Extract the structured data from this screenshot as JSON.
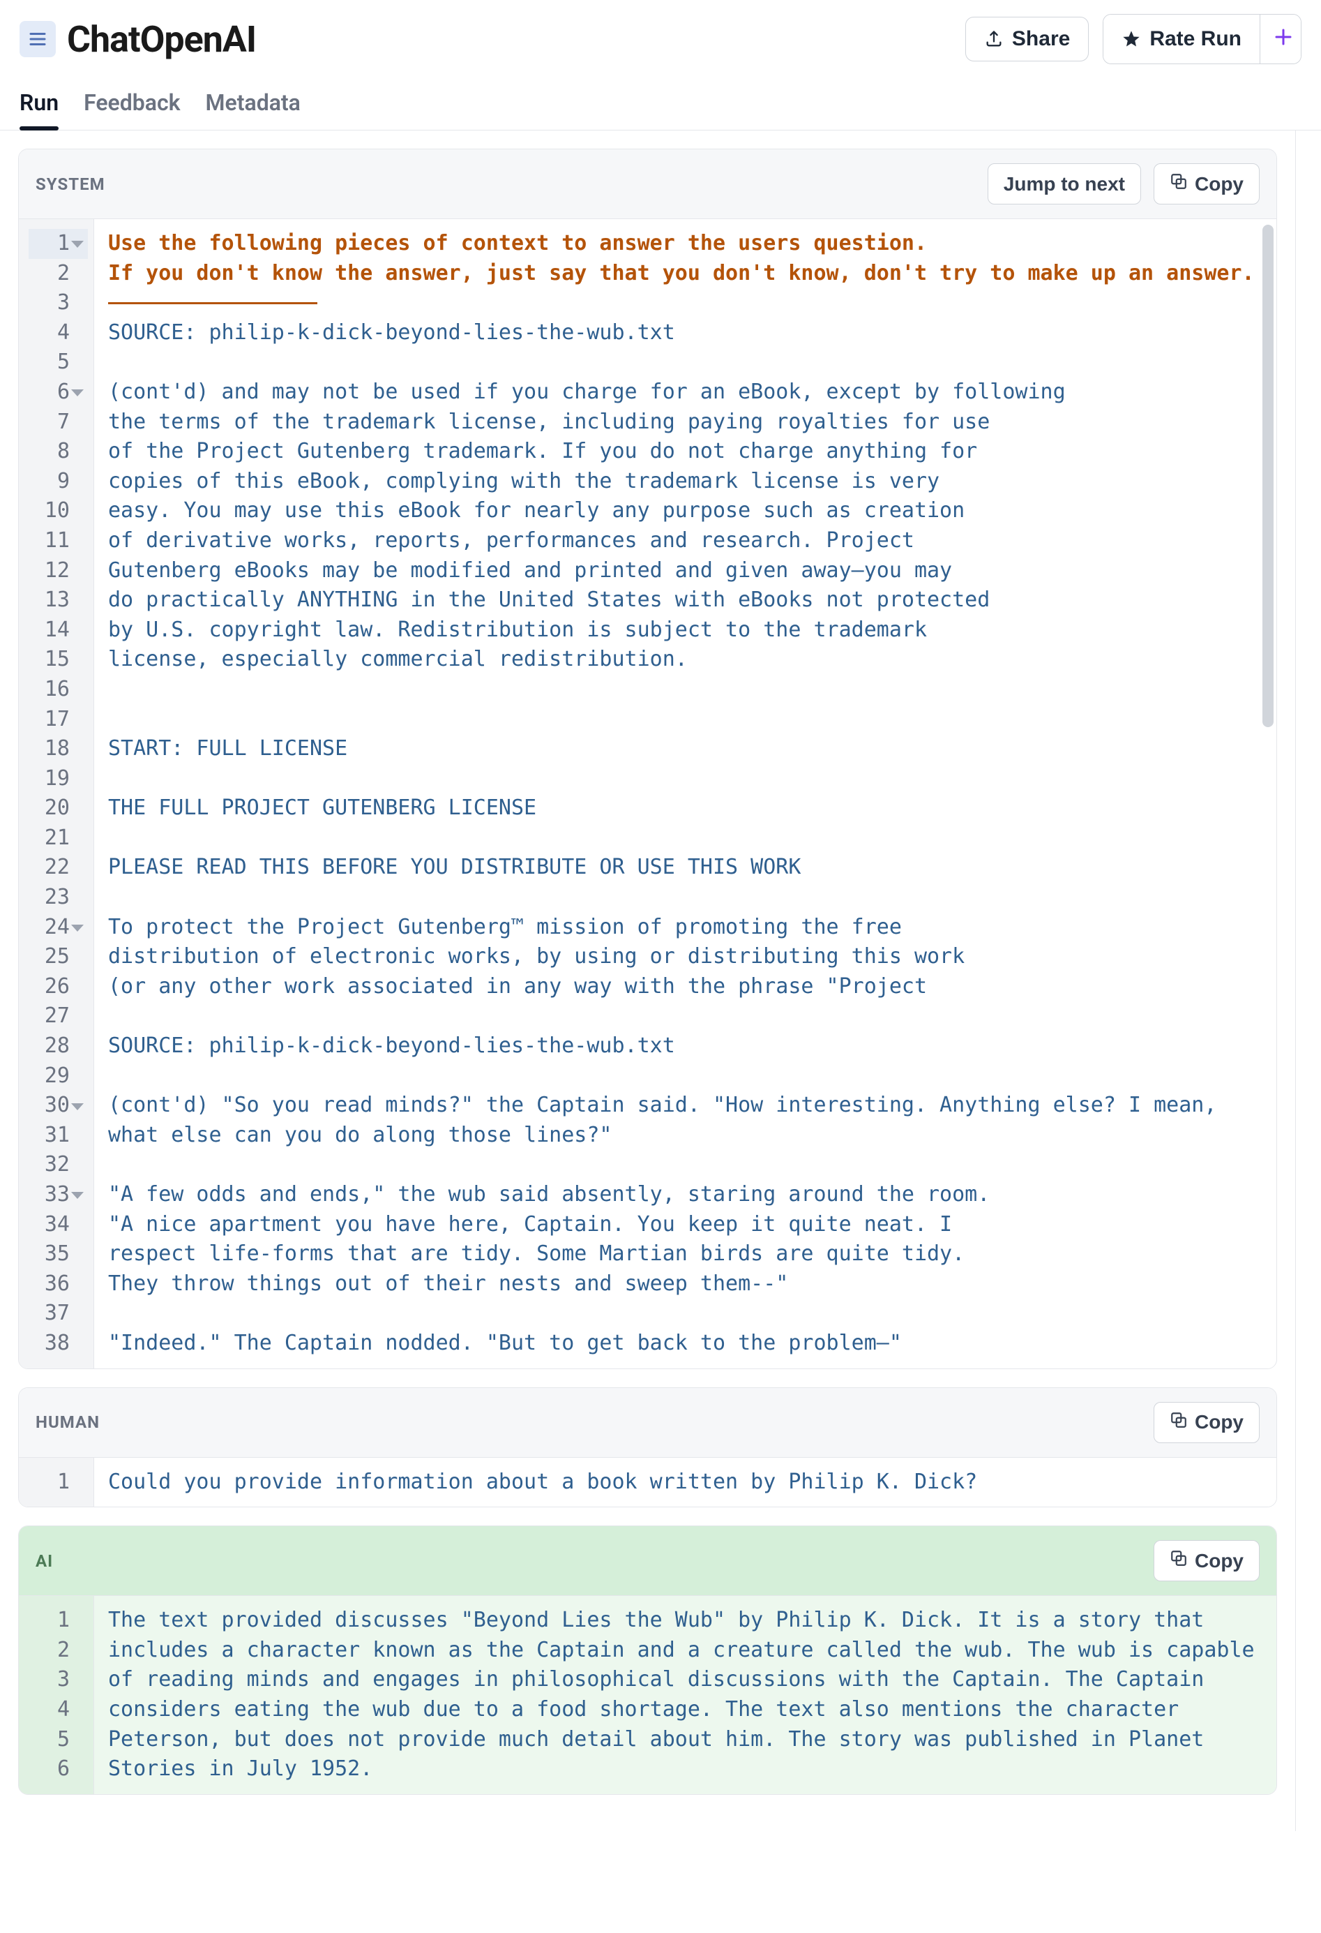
{
  "header": {
    "title": "ChatOpenAI",
    "share_label": "Share",
    "rate_label": "Rate Run"
  },
  "tabs": [
    {
      "label": "Run",
      "active": true
    },
    {
      "label": "Feedback",
      "active": false
    },
    {
      "label": "Metadata",
      "active": false
    }
  ],
  "buttons": {
    "jump_to_next": "Jump to next",
    "copy": "Copy"
  },
  "system": {
    "label": "SYSTEM",
    "fold_lines": [
      1,
      6,
      24,
      30,
      33
    ],
    "selected_line": 1,
    "visible_line_count": 38,
    "lines": [
      {
        "n": 1,
        "text": "Use the following pieces of context to answer the users question.",
        "style": "prompt"
      },
      {
        "n": 2,
        "text": "If you don't know the answer, just say that you don't know, don't try to make up an answer.",
        "style": "prompt"
      },
      {
        "n": 3,
        "text": "",
        "style": "underline"
      },
      {
        "n": 4,
        "text": "SOURCE: philip-k-dick-beyond-lies-the-wub.txt"
      },
      {
        "n": 5,
        "text": ""
      },
      {
        "n": 6,
        "text": "(cont'd) and may not be used if you charge for an eBook, except by following"
      },
      {
        "n": 7,
        "text": "the terms of the trademark license, including paying royalties for use"
      },
      {
        "n": 8,
        "text": "of the Project Gutenberg trademark. If you do not charge anything for"
      },
      {
        "n": 9,
        "text": "copies of this eBook, complying with the trademark license is very"
      },
      {
        "n": 10,
        "text": "easy. You may use this eBook for nearly any purpose such as creation"
      },
      {
        "n": 11,
        "text": "of derivative works, reports, performances and research. Project"
      },
      {
        "n": 12,
        "text": "Gutenberg eBooks may be modified and printed and given away—you may"
      },
      {
        "n": 13,
        "text": "do practically ANYTHING in the United States with eBooks not protected"
      },
      {
        "n": 14,
        "text": "by U.S. copyright law. Redistribution is subject to the trademark"
      },
      {
        "n": 15,
        "text": "license, especially commercial redistribution."
      },
      {
        "n": 16,
        "text": ""
      },
      {
        "n": 17,
        "text": ""
      },
      {
        "n": 18,
        "text": "START: FULL LICENSE"
      },
      {
        "n": 19,
        "text": ""
      },
      {
        "n": 20,
        "text": "THE FULL PROJECT GUTENBERG LICENSE"
      },
      {
        "n": 21,
        "text": ""
      },
      {
        "n": 22,
        "text": "PLEASE READ THIS BEFORE YOU DISTRIBUTE OR USE THIS WORK"
      },
      {
        "n": 23,
        "text": ""
      },
      {
        "n": 24,
        "text": "To protect the Project Gutenberg™ mission of promoting the free"
      },
      {
        "n": 25,
        "text": "distribution of electronic works, by using or distributing this work"
      },
      {
        "n": 26,
        "text": "(or any other work associated in any way with the phrase \"Project"
      },
      {
        "n": 27,
        "text": ""
      },
      {
        "n": 28,
        "text": "SOURCE: philip-k-dick-beyond-lies-the-wub.txt"
      },
      {
        "n": 29,
        "text": ""
      },
      {
        "n": 30,
        "text": "(cont'd) \"So you read minds?\" the Captain said. \"How interesting. Anything else? I mean, what else can you do along those lines?\""
      },
      {
        "n": 31,
        "text": ""
      },
      {
        "n": 32,
        "text": "\"A few odds and ends,\" the wub said absently, staring around the room."
      },
      {
        "n": 33,
        "text": "\"A nice apartment you have here, Captain. You keep it quite neat. I"
      },
      {
        "n": 34,
        "text": "respect life-forms that are tidy. Some Martian birds are quite tidy."
      },
      {
        "n": 35,
        "text": "They throw things out of their nests and sweep them--\""
      },
      {
        "n": 36,
        "text": ""
      },
      {
        "n": 37,
        "text": "\"Indeed.\" The Captain nodded. \"But to get back to the problem—\""
      }
    ]
  },
  "human": {
    "label": "HUMAN",
    "lines": [
      {
        "n": 1,
        "text": "Could you provide information about a book written by Philip K. Dick?"
      }
    ]
  },
  "ai": {
    "label": "AI",
    "lines": [
      {
        "n": 1,
        "text": "The text provided discusses \"Beyond Lies the Wub\" by Philip K. Dick. It is a story that includes a character known as the Captain and a creature called the wub. The wub is capable of reading minds and engages in philosophical discussions with the Captain. The Captain considers eating the wub due to a food shortage. The text also mentions the character Peterson, but does not provide much detail about him. The story was published in Planet Stories in July 1952."
      }
    ]
  }
}
